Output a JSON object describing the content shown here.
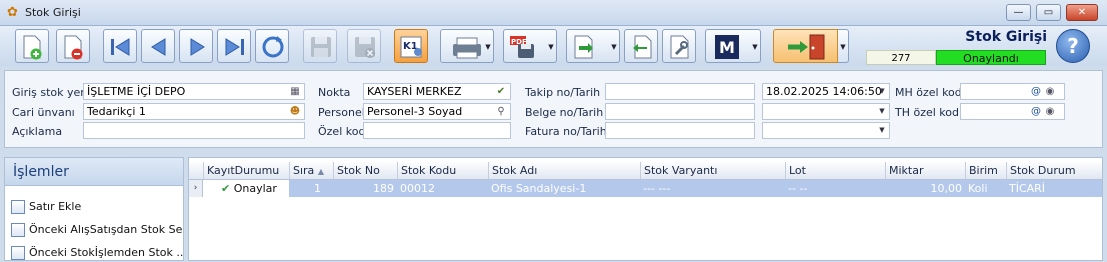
{
  "window": {
    "title": "Stok Girişi"
  },
  "header": {
    "title": "Stok Girişi",
    "doc_no": "277",
    "status": "Onaylandı",
    "help_icon": "?"
  },
  "toolbar": {
    "new_icon": "document-add-icon",
    "delete_icon": "document-delete-icon",
    "nav_first": "first-record-icon",
    "nav_prev": "previous-record-icon",
    "nav_next": "next-record-icon",
    "nav_last": "last-record-icon",
    "refresh": "refresh-icon",
    "save": "save-icon",
    "save_close": "save-close-icon",
    "k1_label": "K1",
    "m_label": "M"
  },
  "form": {
    "giris_stok_yeri_label": "Giriş stok yeri",
    "giris_stok_yeri_value": "İŞLETME İÇİ DEPO",
    "cari_unvani_label": "Cari ünvanı",
    "cari_unvani_value": "Tedarikçi 1",
    "aciklama_label": "Açıklama",
    "aciklama_value": "",
    "nokta_label": "Nokta",
    "nokta_value": "KAYSERİ MERKEZ",
    "personel_label": "Personel",
    "personel_value": "Personel-3 Soyad",
    "ozel_kod_label": "Özel kod",
    "ozel_kod_value": "",
    "takip_label": "Takip no/Tarih",
    "takip_value": "",
    "takip_date": "18.02.2025 14:06:50",
    "belge_label": "Belge no/Tarih",
    "belge_value": "",
    "belge_date": "",
    "fatura_label": "Fatura no/Tarih",
    "fatura_value": "",
    "fatura_date": "",
    "mh_ozel_kod_label": "MH özel kod",
    "mh_ozel_kod_value": "",
    "th_ozel_kod_label": "TH özel kod",
    "th_ozel_kod_value": ""
  },
  "islemler": {
    "title": "İşlemler",
    "items": [
      {
        "label": "Satır Ekle"
      },
      {
        "label": "Önceki AlışSatışdan Stok Seç"
      },
      {
        "label": "Önceki Stokİşlemden Stok ..."
      }
    ]
  },
  "grid": {
    "columns": [
      "KayıtDurumu",
      "Sıra",
      "Stok No",
      "Stok Kodu",
      "Stok Adı",
      "Stok Varyantı",
      "Lot",
      "Miktar",
      "Birim",
      "Stok Durum"
    ],
    "rows": [
      {
        "kayit_durumu": "Onaylar",
        "sira": "1",
        "stok_no": "189",
        "stok_kodu": "00012",
        "stok_adi": "Ofis Sandalyesi-1",
        "stok_varyanti": "--- ---",
        "lot": "-- --",
        "miktar": "10,00",
        "birim": "Koli",
        "stok_durum": "TİCARİ"
      }
    ]
  }
}
